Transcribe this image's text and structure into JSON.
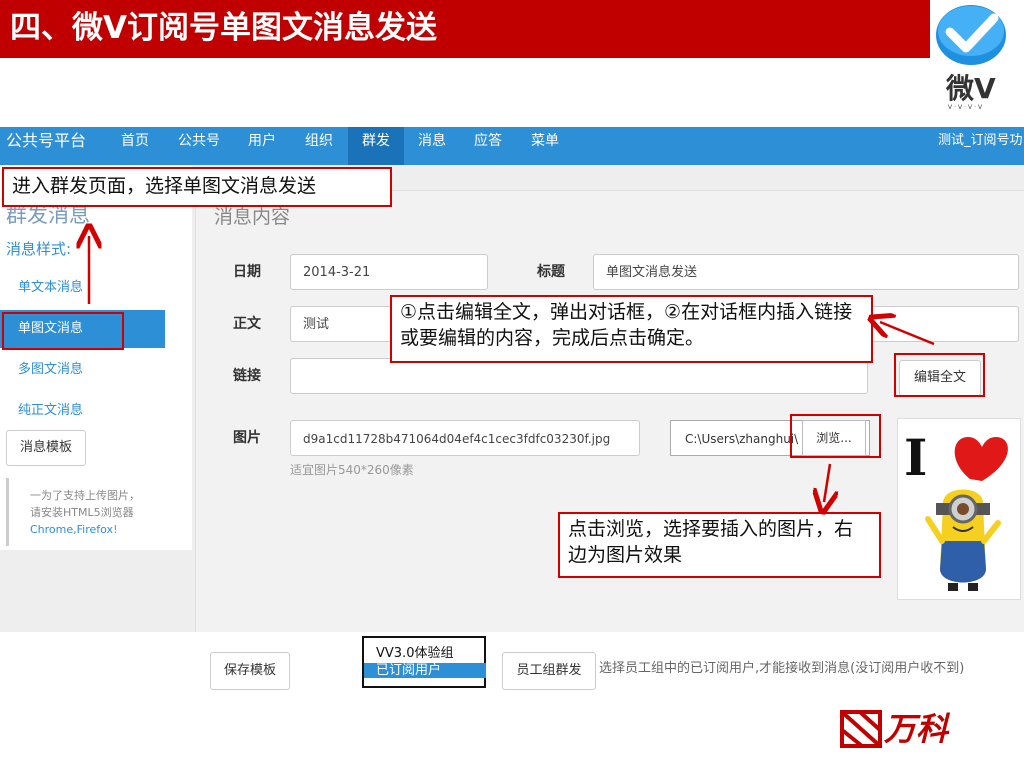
{
  "slide": {
    "title": "四、微V订阅号单图文消息发送",
    "logo_text": "微V",
    "logo_sub": "V·V·V·V"
  },
  "navbar": {
    "brand": "公共号平台",
    "items": [
      "首页",
      "公共号",
      "用户",
      "组织",
      "群发",
      "消息",
      "应答",
      "菜单"
    ],
    "active": "群发",
    "user": "测试_订阅号功"
  },
  "sidebar": {
    "title": "群发消息",
    "subtitle": "消息样式:",
    "items": [
      "单文本消息",
      "单图文消息",
      "多图文消息",
      "纯正文消息"
    ],
    "active": "单图文消息",
    "template_button": "消息模板",
    "note_prefix": "一为了支持上传图片，请安装HTML5浏览器",
    "note_links": "Chrome,Firefox",
    "note_suffix": "!"
  },
  "panel": {
    "title": "消息内容",
    "date_label": "日期",
    "date_value": "2014-3-21",
    "title_label": "标题",
    "title_value": "单图文消息发送",
    "body_label": "正文",
    "body_value": "测试",
    "link_label": "链接",
    "link_value": "",
    "image_label": "图片",
    "image_value": "d9a1cd11728b471064d04ef4c1cec3fdfc03230f.jpg",
    "image_hint": "适宜图片540*260像素",
    "edit_button": "编辑全文",
    "file_path": "C:\\Users\\zhanghui\\",
    "browse_button": "浏览...",
    "preview_text": "I"
  },
  "bottom": {
    "save_template_button": "保存模板",
    "group_options": [
      "VV3.0体验组",
      "已订阅用户"
    ],
    "selected_group": "已订阅用户",
    "staff_button": "员工组群发",
    "staff_hint": "选择员工组中的已订阅用户,才能接收到消息(没订阅用户收不到)"
  },
  "callouts": {
    "enter_page": "进入群发页面，选择单图文消息发送",
    "edit_full": "①点击编辑全文，弹出对话框，②在对话框内插入链接或要编辑的内容，完成后点击确定。",
    "browse": "点击浏览，选择要插入的图片，右边为图片效果"
  },
  "footer": {
    "brand": "万科"
  },
  "colors": {
    "header_red": "#c00000",
    "nav_blue": "#2d8fd5",
    "nav_active": "#1a73b8",
    "callout_border": "#d00000"
  }
}
